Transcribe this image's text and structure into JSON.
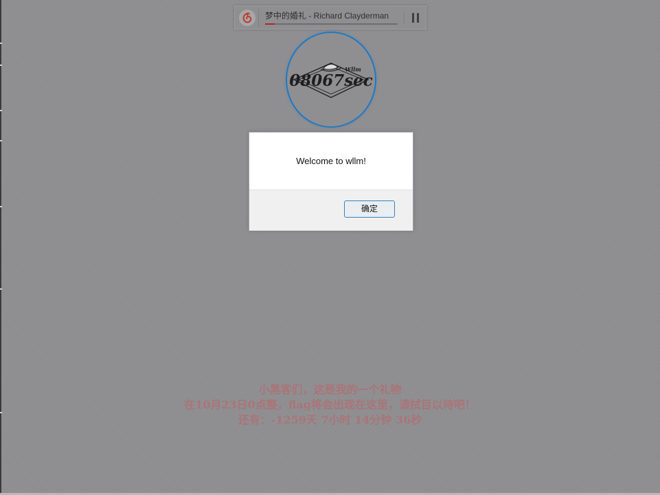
{
  "player": {
    "song_title": "梦中的婚礼 - Richard Clayderman",
    "progress_fraction": 0.07,
    "logo_icon": "music-service-logo-icon",
    "pause_icon": "pause-icon",
    "accent_color": "#c0392b"
  },
  "avatar": {
    "logo_text": "08067sec",
    "logo_subtext": "Wllm",
    "border_color": "#2378c0"
  },
  "dialog": {
    "message": "Welcome to wllm!",
    "ok_label": "确定"
  },
  "countdown": {
    "line1": "小黑客们，这是我的一个礼物",
    "line2": "在10月23日0点整，flag将会出现在这里，请拭目以待吧！",
    "line3": "还有：-1259天 7小时 14分钟 36秒",
    "color": "#aa7478"
  }
}
